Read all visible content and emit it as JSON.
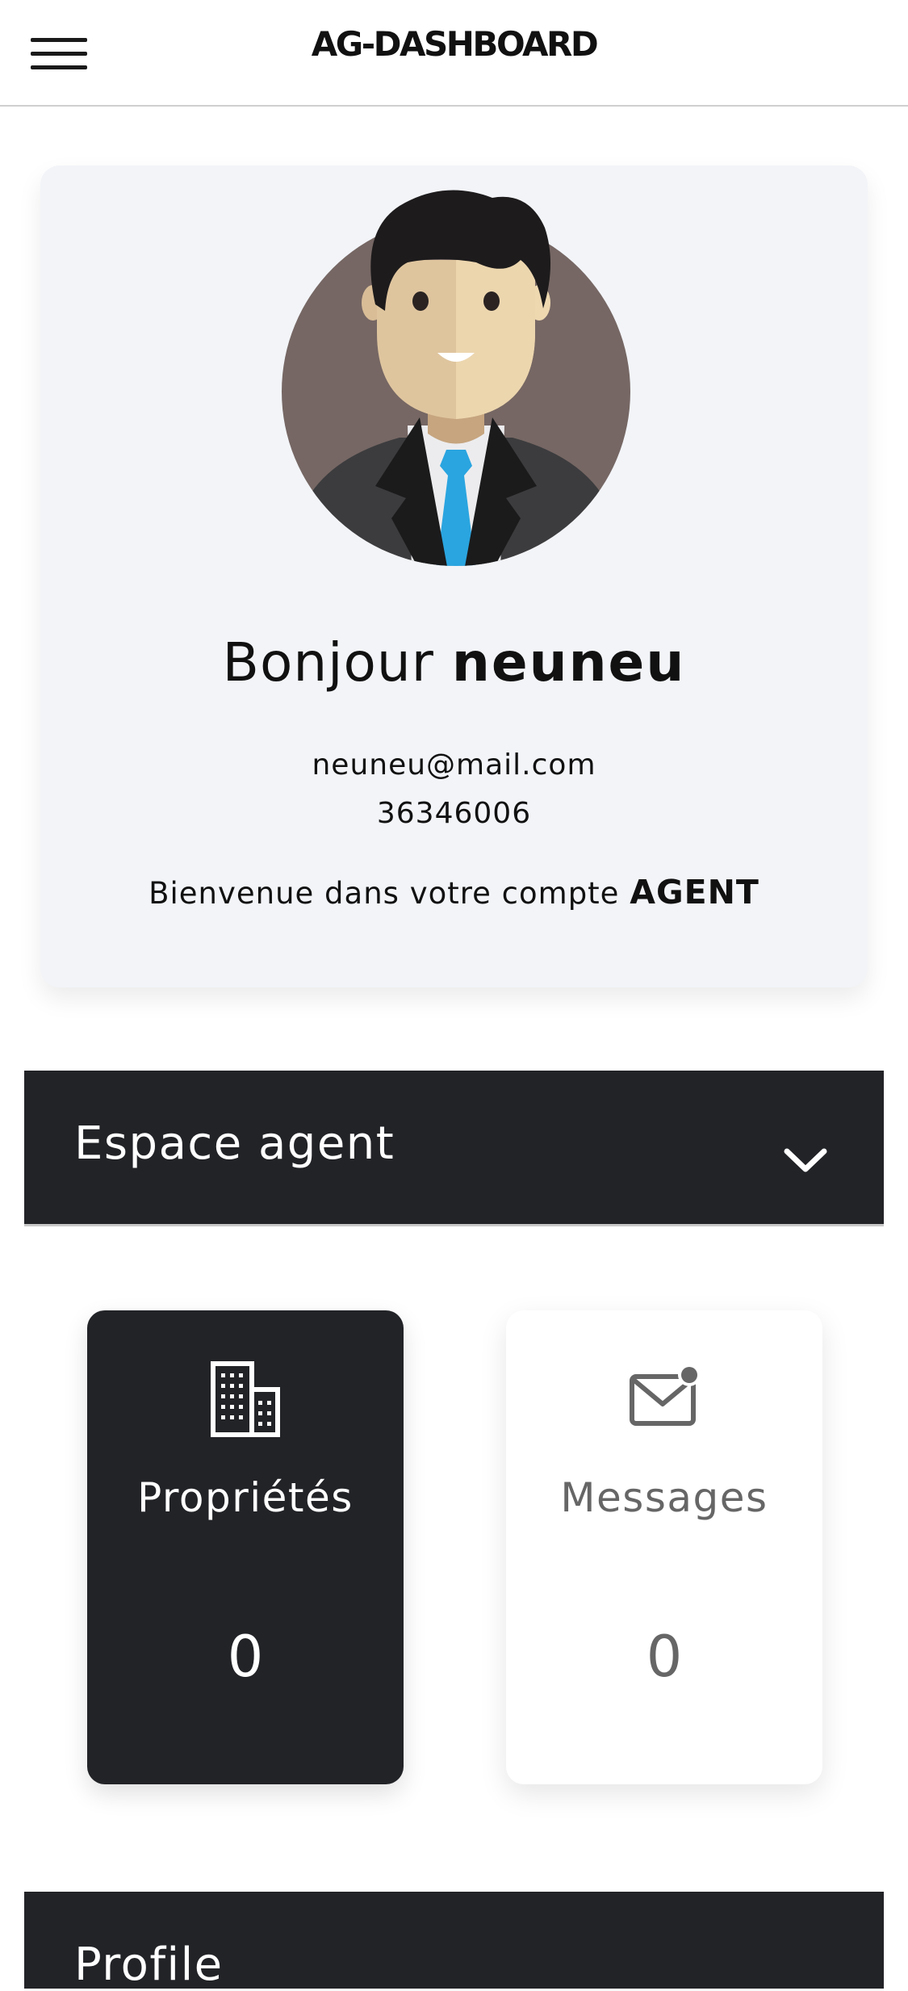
{
  "header": {
    "brand": "AG-DASHBOARD",
    "menu_icon": "hamburger-menu-icon"
  },
  "profile": {
    "avatar_icon": "businessman-avatar",
    "greeting_prefix": "Bonjour",
    "username": "neuneu",
    "email": "neuneu@mail.com",
    "phone": "36346006",
    "welcome_prefix": "Bienvenue dans votre compte",
    "account_type": "AGENT"
  },
  "agent_space": {
    "title": "Espace agent",
    "toggle_icon": "chevron-down-icon"
  },
  "stats": [
    {
      "label": "Propriétés",
      "count": "0",
      "icon": "building-icon"
    },
    {
      "label": "Messages",
      "count": "0",
      "icon": "mail-notification-icon"
    }
  ],
  "profile_section": {
    "title": "Profile"
  },
  "colors": {
    "dark": "#222327",
    "card_bg": "#f2f4f8",
    "tie": "#2aa5e0",
    "avatar_bg": "#766764"
  }
}
